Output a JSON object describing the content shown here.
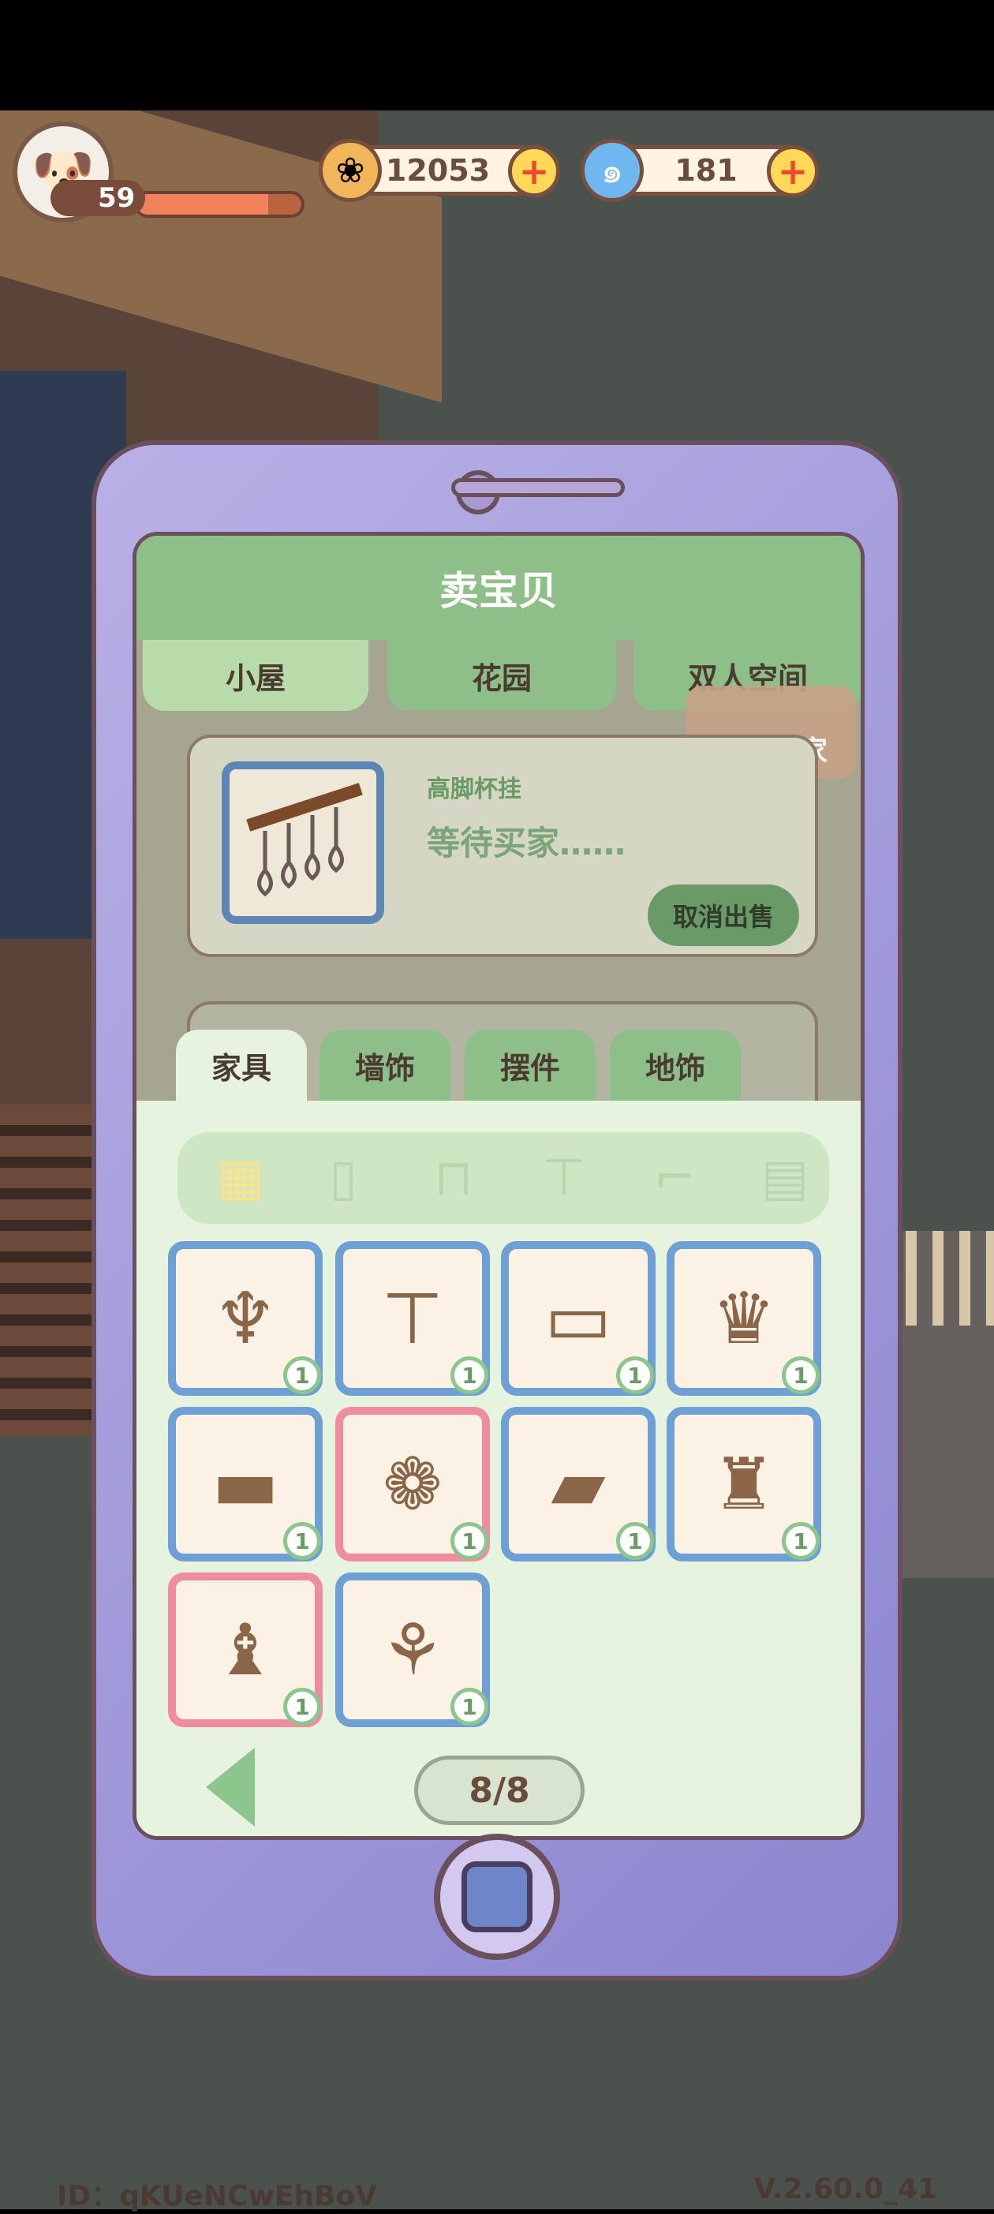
{
  "hud": {
    "player_level": "59",
    "level_progress": 0.8,
    "coins": "12053",
    "gems": "181",
    "plus_symbol": "+"
  },
  "dialog": {
    "title": "卖宝贝",
    "top_tabs": [
      "小屋",
      "花园",
      "双人空间"
    ],
    "active_top_tab": "小屋",
    "summon_label": "呼唤买家",
    "listing": {
      "item_name": "高脚杯挂",
      "status": "等待买家……",
      "cancel_label": "取消出售"
    },
    "category_tabs": [
      "家具",
      "墙饰",
      "摆件",
      "地饰"
    ],
    "active_category": "家具",
    "sub_filters": [
      "grid-icon",
      "fridge-icon",
      "toilet-icon",
      "table-icon",
      "bed-icon",
      "cabinet-icon"
    ],
    "inventory": [
      {
        "icon": "lamp-icon",
        "count": "1",
        "rare": false
      },
      {
        "icon": "desk-icon",
        "count": "1",
        "rare": false
      },
      {
        "icon": "glass-table-icon",
        "count": "1",
        "rare": false
      },
      {
        "icon": "armchair-icon",
        "count": "1",
        "rare": false
      },
      {
        "icon": "sofa-icon",
        "count": "1",
        "rare": false
      },
      {
        "icon": "screen-icon",
        "count": "1",
        "rare": true
      },
      {
        "icon": "grill-icon",
        "count": "1",
        "rare": false
      },
      {
        "icon": "stove-icon",
        "count": "1",
        "rare": false
      },
      {
        "icon": "wooden-chair-icon",
        "count": "1",
        "rare": true
      },
      {
        "icon": "vase-icon",
        "count": "1",
        "rare": false
      }
    ],
    "page_indicator": "8/8"
  },
  "footer": {
    "user_id": "ID：qKUeNCwEhBoV",
    "version": "V.2.60.0_41"
  },
  "colors": {
    "panel_green": "#8fbf88",
    "panel_light": "#e6f3df",
    "phone_purple": "#9c94d8",
    "outline_brown": "#6a4f5c"
  }
}
